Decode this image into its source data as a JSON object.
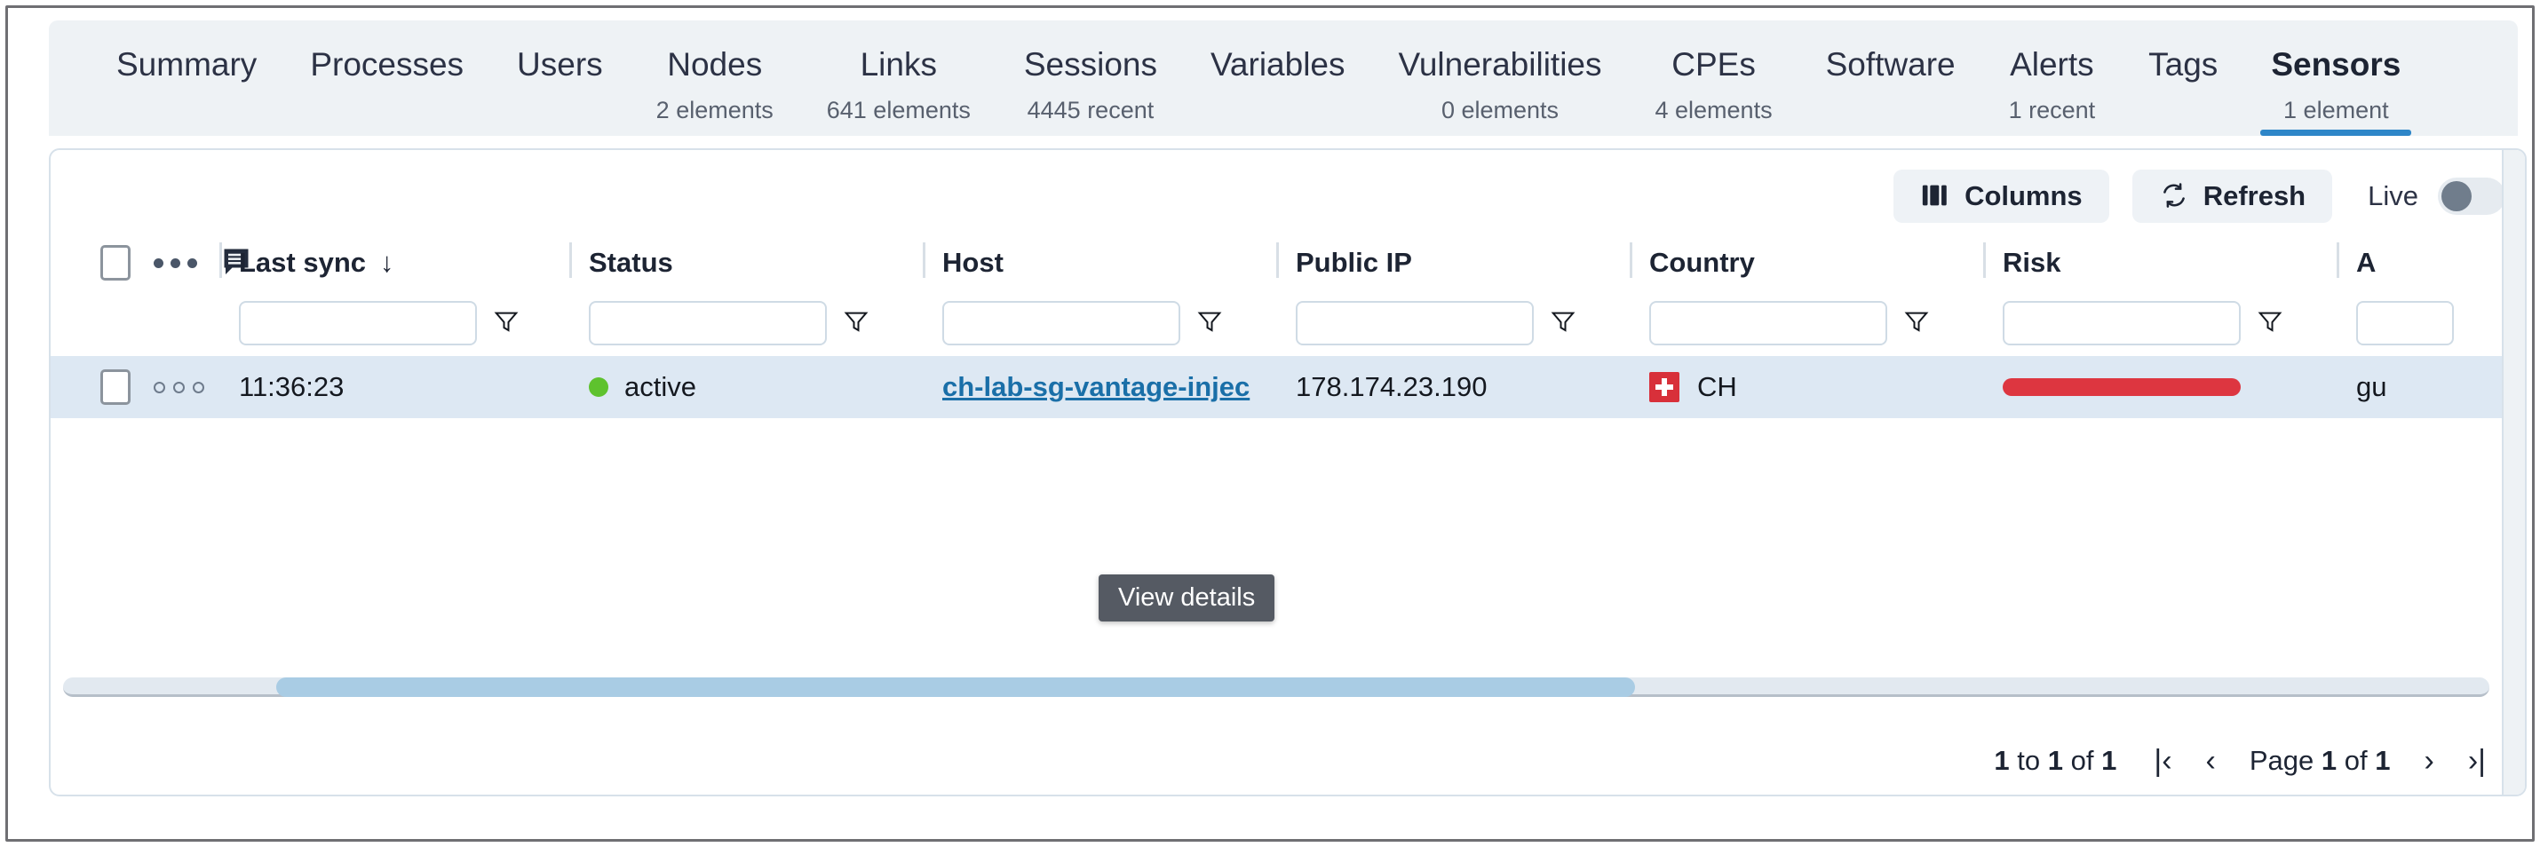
{
  "tabs": [
    {
      "label": "Summary",
      "sub": "",
      "active": false
    },
    {
      "label": "Processes",
      "sub": "",
      "active": false
    },
    {
      "label": "Users",
      "sub": "",
      "active": false
    },
    {
      "label": "Nodes",
      "sub": "2 elements",
      "active": false
    },
    {
      "label": "Links",
      "sub": "641 elements",
      "active": false
    },
    {
      "label": "Sessions",
      "sub": "4445 recent",
      "active": false
    },
    {
      "label": "Variables",
      "sub": "",
      "active": false
    },
    {
      "label": "Vulnerabilities",
      "sub": "0 elements",
      "active": false
    },
    {
      "label": "CPEs",
      "sub": "4 elements",
      "active": false
    },
    {
      "label": "Software",
      "sub": "",
      "active": false
    },
    {
      "label": "Alerts",
      "sub": "1 recent",
      "active": false
    },
    {
      "label": "Tags",
      "sub": "",
      "active": false
    },
    {
      "label": "Sensors",
      "sub": "1 element",
      "active": true
    }
  ],
  "toolbar": {
    "columns_label": "Columns",
    "refresh_label": "Refresh",
    "live_label": "Live",
    "live_on": false
  },
  "table": {
    "columns": [
      {
        "title": "Last sync",
        "sorted": true,
        "sort_dir": "↓"
      },
      {
        "title": "Status",
        "sorted": false,
        "sort_dir": ""
      },
      {
        "title": "Host",
        "sorted": false,
        "sort_dir": ""
      },
      {
        "title": "Public IP",
        "sorted": false,
        "sort_dir": ""
      },
      {
        "title": "Country",
        "sorted": false,
        "sort_dir": ""
      },
      {
        "title": "Risk",
        "sorted": false,
        "sort_dir": ""
      },
      {
        "title": "A",
        "sorted": false,
        "sort_dir": ""
      }
    ],
    "filters": {
      "last_sync": "",
      "status": "",
      "host": "",
      "public_ip": "",
      "country": "",
      "risk": "",
      "app": ""
    },
    "rows": [
      {
        "badge_count": "0",
        "last_sync": "11:36:23",
        "status": "active",
        "status_color": "#5ec22e",
        "host": "ch-lab-sg-vantage-injec",
        "public_ip": "178.174.23.190",
        "country": "CH",
        "country_flag": "swiss-flag",
        "risk_color": "#dd3640",
        "app": "gu"
      }
    ]
  },
  "tooltip": {
    "text": "View details"
  },
  "pagination": {
    "range_prefix": "1",
    "range_mid": "to",
    "range_end": "1",
    "range_of": "of",
    "range_total": "1",
    "summary": "1 to 1 of 1",
    "page_word": "Page",
    "page_current": "1",
    "page_of": "of",
    "page_total": "1",
    "first_icon": "|‹",
    "prev_icon": "‹",
    "next_icon": "›",
    "last_icon": "›|"
  },
  "colors": {
    "accent": "#2e86c8",
    "tabbar_bg": "#eef2f5",
    "row_selected_bg": "#dde8f3",
    "link": "#1a6fa8",
    "risk_red": "#dd3640",
    "status_green": "#5ec22e",
    "tooltip_bg": "#555a63"
  }
}
